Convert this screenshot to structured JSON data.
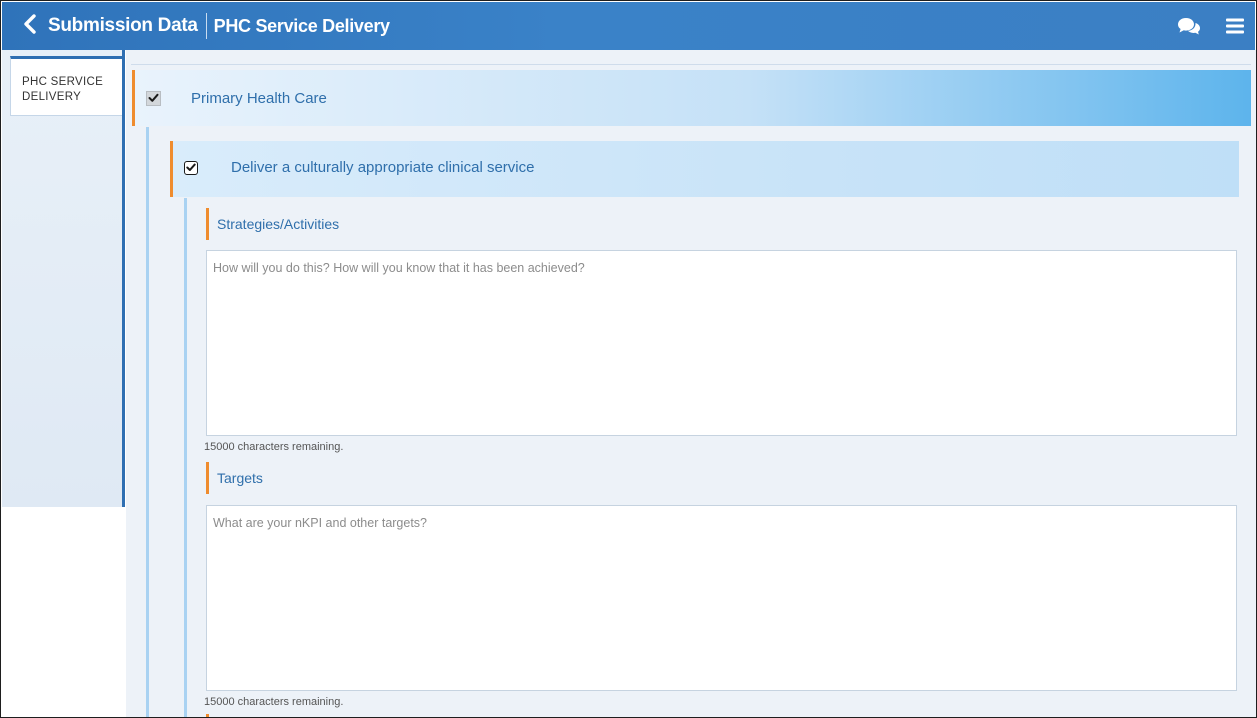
{
  "header": {
    "title": "Submission Data",
    "subtitle": "PHC Service Delivery",
    "icons": [
      "back-chevron-icon",
      "chat-icon",
      "menu-icon"
    ]
  },
  "sidebar": {
    "tab_label": "PHC SERVICE DELIVERY"
  },
  "main": {
    "section": {
      "label": "Primary Health Care",
      "checked": true,
      "subsection": {
        "label": "Deliver a culturally appropriate clinical service",
        "checked": true,
        "fields": [
          {
            "label": "Strategies/Activities",
            "placeholder": "How will you do this? How will you know that it has been achieved?",
            "value": "",
            "remaining": "15000 characters remaining."
          },
          {
            "label": "Targets",
            "placeholder": "What are your nKPI and other targets?",
            "value": "",
            "remaining": "15000 characters remaining."
          }
        ]
      }
    }
  },
  "colors": {
    "header_blue": "#3a82c8",
    "accent_orange": "#ef8c2e",
    "label_blue": "#2f6fab",
    "section_gradient_end": "#5db4ec"
  }
}
